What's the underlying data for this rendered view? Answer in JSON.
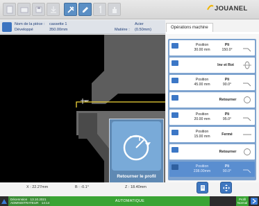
{
  "toolbar": {
    "logo": "JOUANEL"
  },
  "info": {
    "piece_label": "Nom de la pièce :",
    "piece_value": "cassette 1",
    "developpe_label": "Développé",
    "developpe_value": "350.00mm",
    "matiere_label": "Matière :",
    "matiere_value": "Acier",
    "matiere_thickness": "(0.50mm)"
  },
  "tab": {
    "label": "Opérations machine"
  },
  "operations": [
    {
      "num": "1",
      "pos_label": "Position",
      "pos_value": "30.00 mm",
      "pli_label": "Pli",
      "pli_value": "150.0°",
      "icon": "bend-icon"
    },
    {
      "num": "2",
      "action": "Inv et Rot",
      "icon": "invert-rotate-icon"
    },
    {
      "num": "3",
      "pos_label": "Position",
      "pos_value": "45.00 mm",
      "pli_label": "Pli",
      "pli_value": "90.0°",
      "icon": "bend-icon"
    },
    {
      "num": "4",
      "action": "Retourner",
      "icon": "rotate-icon"
    },
    {
      "num": "5",
      "pos_label": "Position",
      "pos_value": "20.00 mm",
      "pli_label": "Pli",
      "pli_value": "95.0°",
      "icon": "bend-icon"
    },
    {
      "num": "6",
      "pos_label": "Position",
      "pos_value": "15.00 mm",
      "action": "Fermé",
      "icon": "close-bend-icon"
    },
    {
      "num": "7",
      "action": "Retourner",
      "icon": "rotate-icon"
    },
    {
      "num": "8",
      "pos_label": "Position",
      "pos_value": "238.00mm",
      "pli_label": "Pli",
      "pli_value": "90.0°",
      "icon": "bend-icon",
      "selected": true
    }
  ],
  "coords": {
    "x": "X : 22.27mm",
    "b": "B : -0.1°",
    "z": "Z : 18.40mm"
  },
  "popup": {
    "caption": "Retourner le profil"
  },
  "status": {
    "line1": "Décennsion",
    "date": "13.10.2021",
    "line2": "ADMINISTRATEUR",
    "time": "14:14",
    "mode": "AUTOMATIQUE",
    "profil_1": "Profil",
    "profil_2": "Normal"
  },
  "colors": {
    "accent": "#3c77c6",
    "status_green": "#3aa434",
    "highlight_yellow": "#f1d53a"
  }
}
